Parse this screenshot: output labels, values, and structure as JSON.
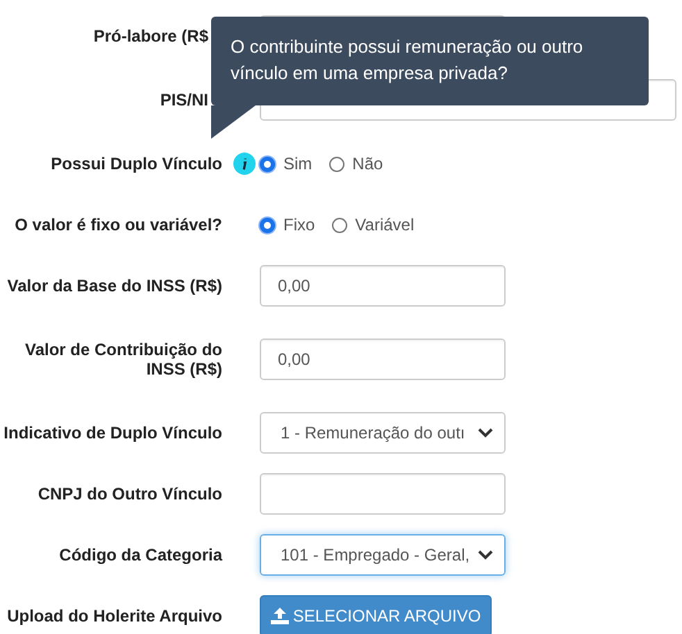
{
  "tooltip": {
    "text": "O contribuinte possui remuneração ou outro vínculo em uma empresa privada?"
  },
  "fields": [
    {
      "kind": "text",
      "label": "Pró-labore (R$"
    },
    {
      "kind": "text",
      "label": "PIS/NI"
    },
    {
      "kind": "radio",
      "label": "Possui Duplo Vínculo",
      "info": true,
      "options": [
        {
          "label": "Sim",
          "selected": true
        },
        {
          "label": "Não",
          "selected": false
        }
      ]
    },
    {
      "kind": "radio",
      "label": "O valor é fixo ou variável?",
      "options": [
        {
          "label": "Fixo",
          "selected": true
        },
        {
          "label": "Variável",
          "selected": false
        }
      ]
    },
    {
      "kind": "text",
      "label": "Valor da Base do INSS (R$)",
      "value": "0,00"
    },
    {
      "kind": "text",
      "label": "Valor de Contribuição do INSS (R$)",
      "value": "0,00"
    },
    {
      "kind": "select",
      "label": "Indicativo de Duplo Vínculo",
      "value": "1 - Remuneração do outı",
      "focused": false
    },
    {
      "kind": "text",
      "label": "CNPJ do Outro Vínculo"
    },
    {
      "kind": "select",
      "label": "Código da Categoria",
      "value": "101 - Empregado - Geral,",
      "focused": true
    },
    {
      "kind": "file",
      "label": "Upload do Holerite Arquivo",
      "button": "SELECIONAR ARQUIVO"
    }
  ]
}
